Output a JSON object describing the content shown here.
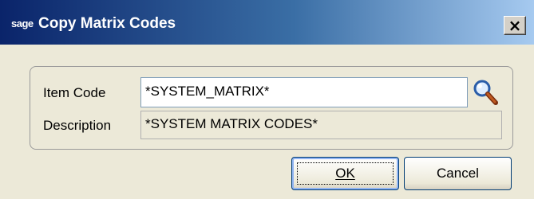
{
  "window": {
    "logo": "sage",
    "title": "Copy Matrix Codes",
    "close_symbol": "×"
  },
  "form": {
    "item_code_label": "Item Code",
    "item_code_value": "*SYSTEM_MATRIX*",
    "description_label": "Description",
    "description_value": "*SYSTEM MATRIX CODES*"
  },
  "buttons": {
    "ok_label": "OK",
    "cancel_label": "Cancel"
  },
  "icons": {
    "lookup": "magnifier-icon",
    "close": "close-icon"
  },
  "colors": {
    "titlebar_start": "#0a246a",
    "titlebar_end": "#a6caf0",
    "dialog_bg": "#ece9d8"
  }
}
